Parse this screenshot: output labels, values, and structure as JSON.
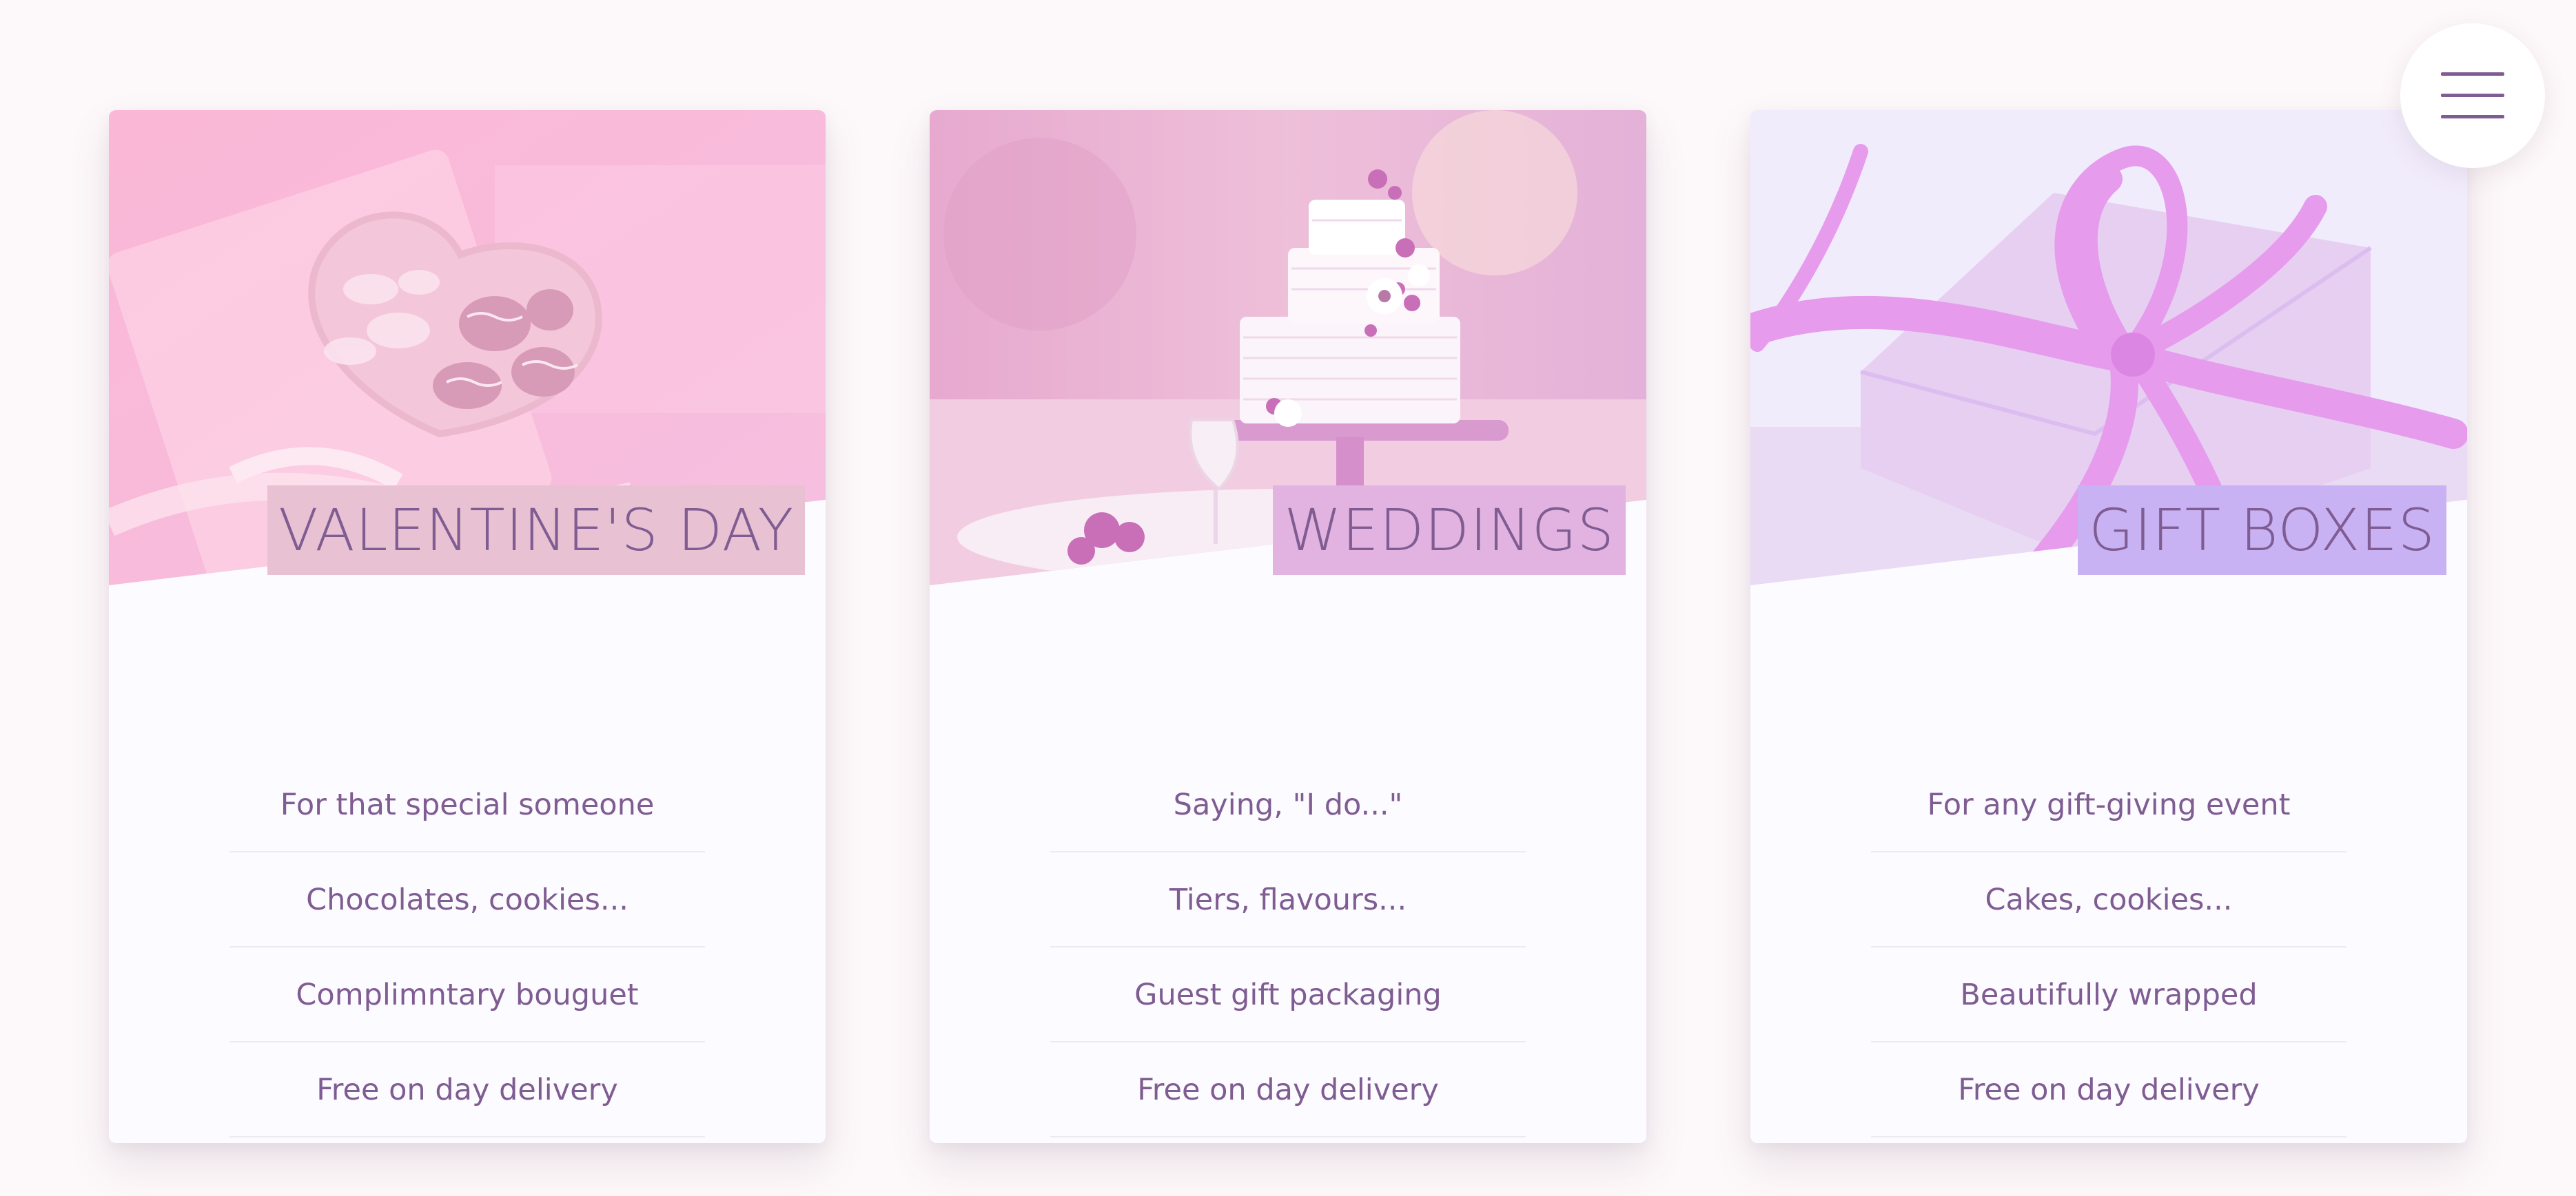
{
  "cards": [
    {
      "title": "VALENTINE'S DAY",
      "image_icon": "heart-box-chocolates-icon",
      "features": [
        "For that special someone",
        "Chocolates, cookies...",
        "Complimntary bouguet",
        "Free on day delivery"
      ],
      "title_bg_color": "#e8c1d2"
    },
    {
      "title": "WEDDINGS",
      "image_icon": "wedding-cake-icon",
      "features": [
        "Saying, \"I do...\"",
        "Tiers, flavours...",
        "Guest gift packaging",
        "Free on day delivery"
      ],
      "title_bg_color": "#e2b3e0"
    },
    {
      "title": "GIFT BOXES",
      "image_icon": "gift-box-ribbon-icon",
      "features": [
        "For any gift-giving event",
        "Cakes, cookies...",
        "Beautifully wrapped",
        "Free on day delivery"
      ],
      "title_bg_color": "#c8b2f4"
    }
  ],
  "menu": {
    "icon": "hamburger-menu-icon"
  },
  "colors": {
    "text": "#7f5c92",
    "card_bg": "#fcfbff",
    "page_bg": "#fdf8fa"
  }
}
